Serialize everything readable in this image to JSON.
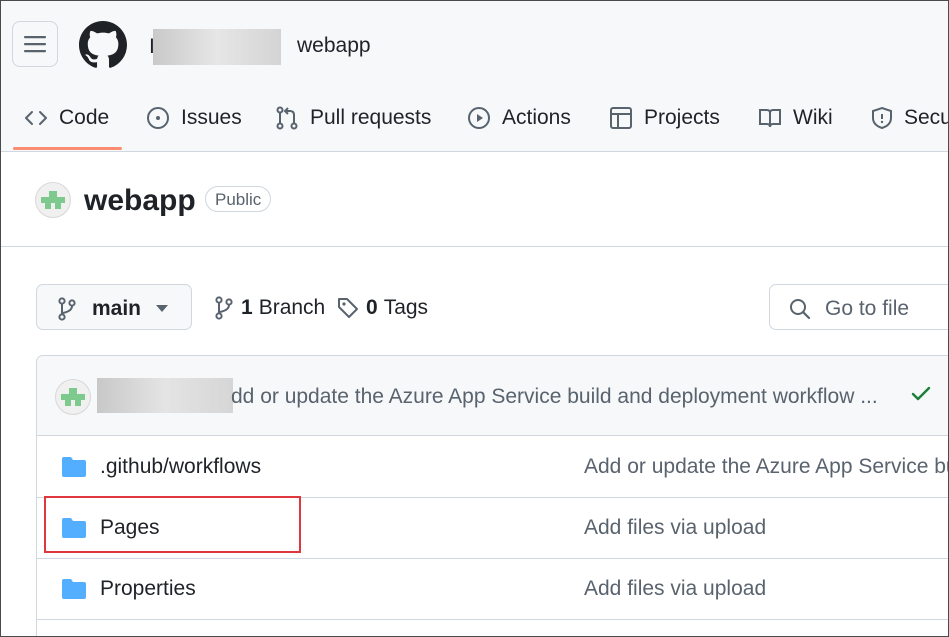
{
  "header": {
    "owner_initial": "I",
    "repo_crumb": "webapp"
  },
  "tabs": [
    {
      "label": "Code",
      "icon": "code-icon"
    },
    {
      "label": "Issues",
      "icon": "issue-opened-icon"
    },
    {
      "label": "Pull requests",
      "icon": "git-pull-request-icon"
    },
    {
      "label": "Actions",
      "icon": "play-icon"
    },
    {
      "label": "Projects",
      "icon": "table-icon"
    },
    {
      "label": "Wiki",
      "icon": "book-icon"
    },
    {
      "label": "Secu",
      "icon": "shield-icon"
    }
  ],
  "repo": {
    "name": "webapp",
    "visibility": "Public"
  },
  "toolbar": {
    "branch": "main",
    "branch_count": "1",
    "branch_label": "Branch",
    "tag_count": "0",
    "tag_label": "Tags",
    "goto_placeholder": "Go to file"
  },
  "latest_commit": {
    "message": "dd or update the Azure App Service build and deployment workflow ..."
  },
  "files": [
    {
      "name": ".github/workflows",
      "message": "Add or update the Azure App Service bu"
    },
    {
      "name": "Pages",
      "message": "Add files via upload"
    },
    {
      "name": "Properties",
      "message": "Add files via upload"
    }
  ],
  "colors": {
    "accent_underline": "#fd8c73",
    "folder": "#54aeff",
    "success": "#1a7f37",
    "highlight": "#e0363d"
  }
}
